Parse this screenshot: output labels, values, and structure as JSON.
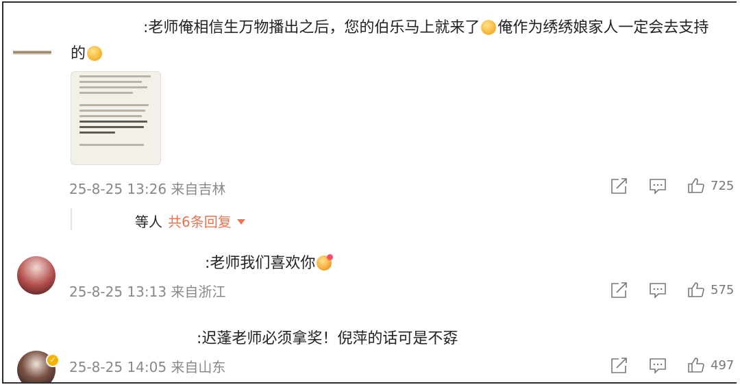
{
  "comments": [
    {
      "text_line1": ":老师俺相信生万物播出之后，您的伯乐马上就来了",
      "text_after_emoji": "俺作为绣绣娘家人一定会去支持",
      "text_line2": "的",
      "emoji1": "crying-face-emoji",
      "emoji2": "crying-face-emoji",
      "timestamp": "25-8-25 13:26",
      "location": "来自吉林",
      "likes": "725",
      "replies": {
        "prefix": "等人",
        "link": "共6条回复"
      }
    },
    {
      "text": ":老师我们喜欢你",
      "emoji": "love-face-emoji",
      "timestamp": "25-8-25 13:13",
      "location": "来自浙江",
      "likes": "575"
    },
    {
      "text": ":迟蓬老师必须拿奖！倪萍的话可是不孬",
      "timestamp": "25-8-25 14:05",
      "location": "来自山东",
      "likes": "497"
    }
  ],
  "colors": {
    "accent": "#eb7350",
    "meta": "#888888",
    "border": "#2b2b2b"
  }
}
